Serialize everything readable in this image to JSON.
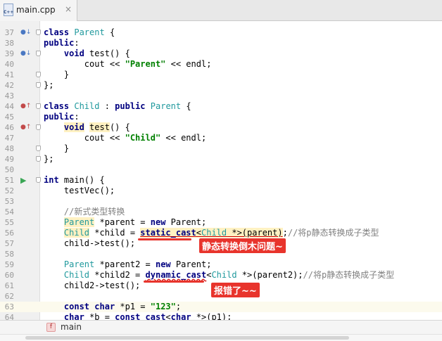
{
  "tab": {
    "title": "main.cpp",
    "icon_label": "C++",
    "close": "×"
  },
  "statusbar": {
    "badge": "f",
    "function": "main"
  },
  "annotations": {
    "static_cast_note": "静态转换倒木问题~",
    "dynamic_cast_note": "报错了~~"
  },
  "colors": {
    "keyword": "#000080",
    "type": "#20999d",
    "string": "#008000",
    "comment": "#808080",
    "annotation": "#e8342c"
  }
}
